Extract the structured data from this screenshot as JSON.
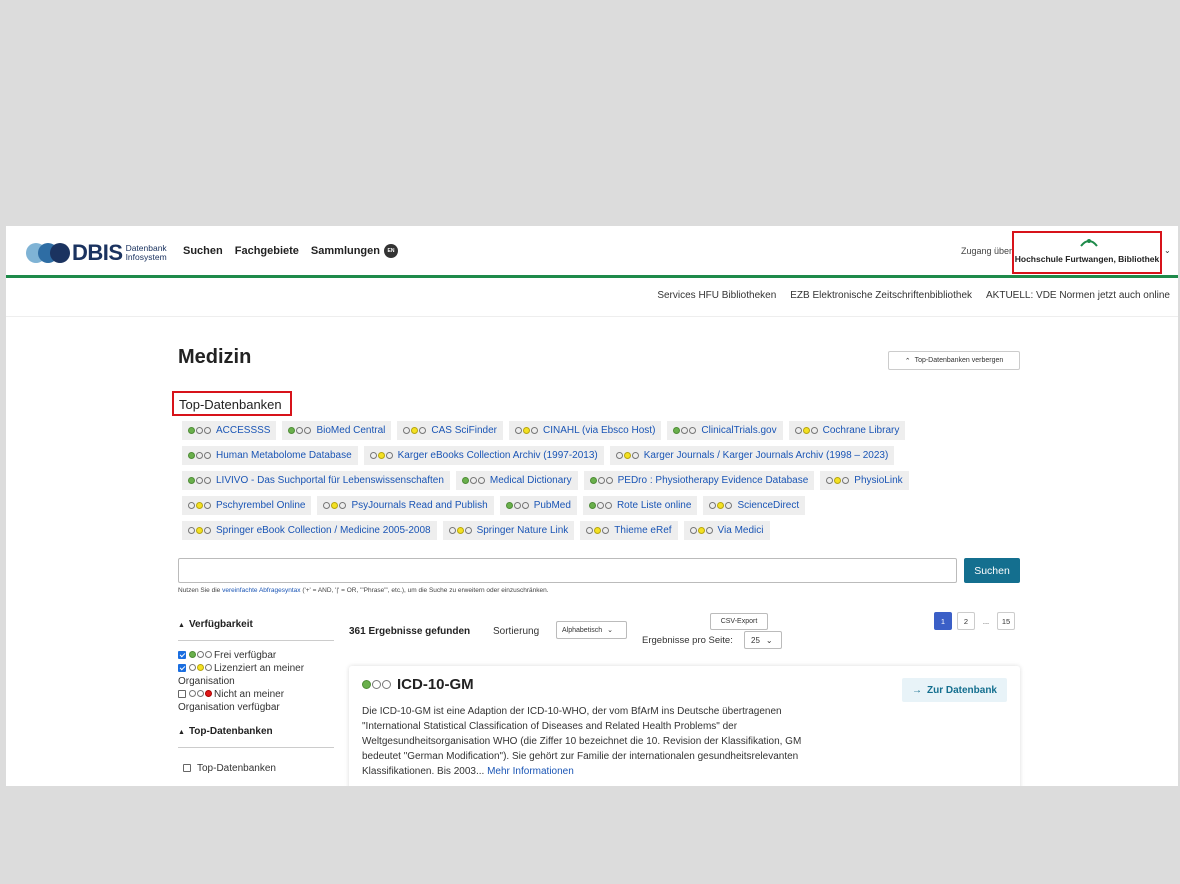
{
  "header": {
    "logo_text": "DBIS",
    "logo_sub_1": "Datenbank",
    "logo_sub_2": "Infosystem",
    "nav": [
      "Suchen",
      "Fachgebiete",
      "Sammlungen"
    ],
    "lang_badge": "EN",
    "access_label": "Zugang über",
    "institution_logo_text": "hfu",
    "institution_name": "Hochschule Furtwangen, Bibliothek"
  },
  "secondary_nav": [
    "Services HFU Bibliotheken",
    "EZB Elektronische Zeitschriftenbibliothek",
    "AKTUELL: VDE Normen jetzt auch online"
  ],
  "page_title": "Medizin",
  "hide_top_label": "Top-Datenbanken verbergen",
  "top_heading": "Top-Datenbanken",
  "top_databases": [
    [
      {
        "label": "ACCESSSS",
        "light": "green"
      },
      {
        "label": "BioMed Central",
        "light": "green"
      },
      {
        "label": "CAS SciFinder",
        "light": "yellow"
      },
      {
        "label": "CINAHL (via Ebsco Host)",
        "light": "yellow"
      },
      {
        "label": "ClinicalTrials.gov",
        "light": "green"
      },
      {
        "label": "Cochrane Library",
        "light": "yellow"
      }
    ],
    [
      {
        "label": "Human Metabolome Database",
        "light": "green"
      },
      {
        "label": "Karger eBooks Collection Archiv (1997-2013)",
        "light": "yellow"
      },
      {
        "label": "Karger Journals / Karger Journals Archiv (1998 – 2023)",
        "light": "yellow"
      }
    ],
    [
      {
        "label": "LIVIVO - Das Suchportal für Lebenswissenschaften",
        "light": "green"
      },
      {
        "label": "Medical Dictionary",
        "light": "green"
      },
      {
        "label": "PEDro : Physiotherapy Evidence Database",
        "light": "green"
      },
      {
        "label": "PhysioLink",
        "light": "yellow"
      }
    ],
    [
      {
        "label": "Pschyrembel Online",
        "light": "yellow"
      },
      {
        "label": "PsyJournals Read and Publish",
        "light": "yellow"
      },
      {
        "label": "PubMed",
        "light": "green"
      },
      {
        "label": "Rote Liste online",
        "light": "green"
      },
      {
        "label": "ScienceDirect",
        "light": "yellow"
      }
    ],
    [
      {
        "label": "Springer eBook Collection / Medicine 2005-2008",
        "light": "yellow"
      },
      {
        "label": "Springer Nature Link",
        "light": "yellow"
      },
      {
        "label": "Thieme eRef",
        "light": "yellow"
      },
      {
        "label": "Via Medici",
        "light": "yellow"
      }
    ]
  ],
  "search": {
    "value": "",
    "button": "Suchen",
    "hint_prefix": "Nutzen Sie die",
    "hint_link": "vereinfachte Abfragesyntax",
    "hint_suffix": "('+' = AND, '|' = OR, '\"Phrase\"', etc.), um die Suche zu erweitern oder einzuschränken."
  },
  "filters": {
    "availability_title": "Verfügbarkeit",
    "availability_options": [
      {
        "label": "Frei verfügbar",
        "checked": true,
        "light": "green"
      },
      {
        "label": "Lizenziert an meiner Organisation",
        "checked": true,
        "light": "yellow"
      },
      {
        "label": "Nicht an meiner Organisation verfügbar",
        "checked": false,
        "light": "red"
      }
    ],
    "top_title": "Top-Datenbanken",
    "top_option": "Top-Datenbanken"
  },
  "results": {
    "count": "361 Ergebnisse gefunden",
    "sort_label": "Sortierung",
    "sort_value": "Alphabetisch",
    "csv_export": "CSV-Export",
    "per_page_label": "Ergebnisse pro Seite:",
    "per_page_value": "25",
    "pages": [
      "1",
      "2",
      "...",
      "15"
    ],
    "current_page": "1"
  },
  "result_card": {
    "title": "ICD-10-GM",
    "light": "green",
    "goto_label": "Zur Datenbank",
    "description": "Die ICD-10-GM ist eine Adaption der ICD-10-WHO, der vom BfArM ins Deutsche übertragenen \"International Statistical Classification of Diseases and Related Health Problems\" der Weltgesundheitsorganisation WHO (die Ziffer 10 bezeichnet die 10. Revision der Klassifikation, GM bedeutet \"German Modification\"). Sie gehört zur Familie der internationalen gesundheitsrelevanten Klassifikationen. Bis 2003...",
    "more_link": "Mehr Informationen"
  },
  "colors": {
    "accent_green": "#1e8a4a",
    "search_button": "#146f8f",
    "link_blue": "#1a55b5",
    "highlight_red": "#d7131a",
    "page_active": "#3b5fc7"
  }
}
